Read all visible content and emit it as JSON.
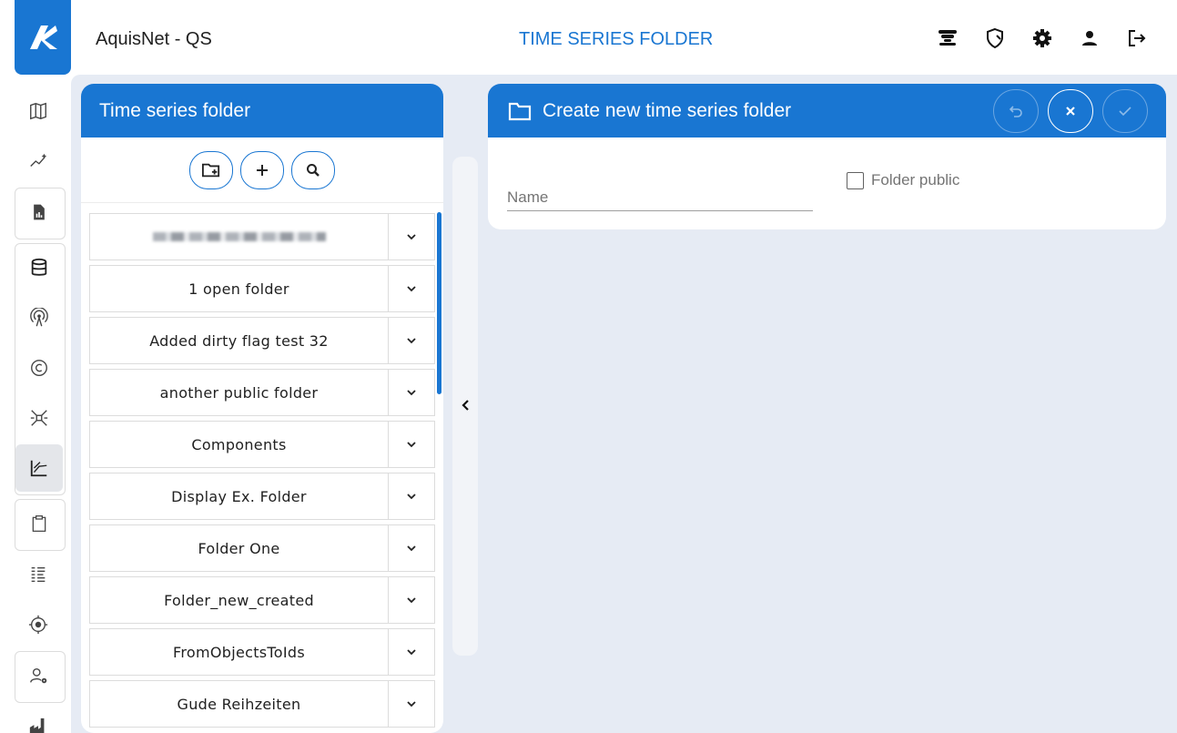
{
  "header": {
    "app_title": "AquisNet - QS",
    "page_title": "TIME SERIES FOLDER",
    "icons": [
      "tornado-icon",
      "shield-icon",
      "gear-icon",
      "user-icon",
      "logout-icon"
    ]
  },
  "sidebar": {
    "items": [
      {
        "icon": "map-icon",
        "active": false
      },
      {
        "icon": "chart-sparkle-icon",
        "active": false
      },
      {
        "icon": "report-file-icon",
        "active": false
      },
      {
        "icon": "database-icon",
        "active": false
      },
      {
        "icon": "broadcast-icon",
        "active": false
      },
      {
        "icon": "copyright-icon",
        "active": false
      },
      {
        "icon": "satellite-icon",
        "active": false
      },
      {
        "icon": "line-chart-icon",
        "active": true
      },
      {
        "icon": "clipboard-icon",
        "active": false
      },
      {
        "icon": "list-icon",
        "active": false
      },
      {
        "icon": "target-icon",
        "active": false
      },
      {
        "icon": "user-settings-icon",
        "active": false
      },
      {
        "icon": "factory-icon",
        "active": false
      }
    ]
  },
  "folder_panel": {
    "title": "Time series folder",
    "toolbar": [
      "new-folder-icon",
      "add-icon",
      "search-icon"
    ],
    "folders": [
      {
        "label": "",
        "redacted": true
      },
      {
        "label": "1 open folder"
      },
      {
        "label": "Added dirty flag test 32"
      },
      {
        "label": "another public folder"
      },
      {
        "label": "Components"
      },
      {
        "label": "Display Ex. Folder"
      },
      {
        "label": "Folder One"
      },
      {
        "label": "Folder_new_created"
      },
      {
        "label": "FromObjectsToIds"
      },
      {
        "label": "Gude Reihzeiten"
      }
    ]
  },
  "create_panel": {
    "title": "Create new time series folder",
    "name_placeholder": "Name",
    "name_value": "",
    "public_label": "Folder public",
    "public_checked": false
  },
  "colors": {
    "accent": "#1976d2",
    "background": "#e6ebf4"
  }
}
